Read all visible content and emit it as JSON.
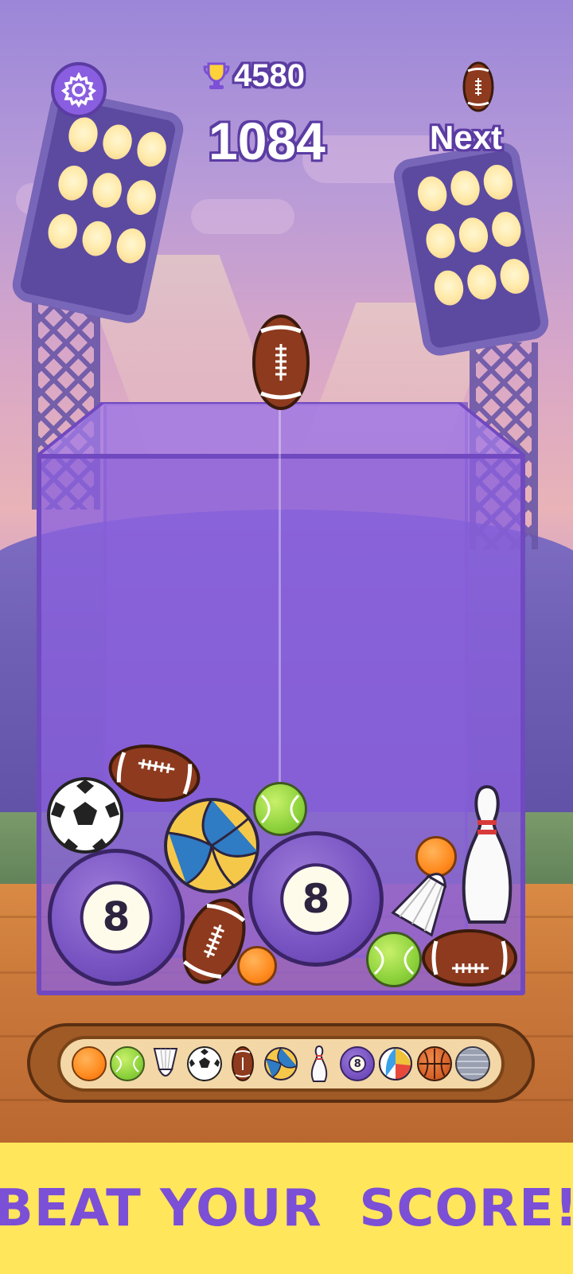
{
  "hud": {
    "best_score": "4580",
    "current_score": "1084",
    "next_label": "Next",
    "next_item_icon": "american-football-icon"
  },
  "banner": {
    "text": "BEAT YOUR  SCORE!"
  },
  "balls": {
    "eight_ball_label": "8"
  },
  "progression_tray": {
    "items": [
      "orange-ball",
      "tennis-ball",
      "shuttlecock",
      "soccer-ball",
      "american-football",
      "volleyball",
      "bowling-pin",
      "eight-ball",
      "beach-ball",
      "basketball",
      "disco-ball"
    ],
    "eight_label": "8"
  },
  "colors": {
    "accent_purple": "#7b4fd6",
    "banner_yellow": "#ffe65a",
    "container_purple": "#8a60de"
  }
}
